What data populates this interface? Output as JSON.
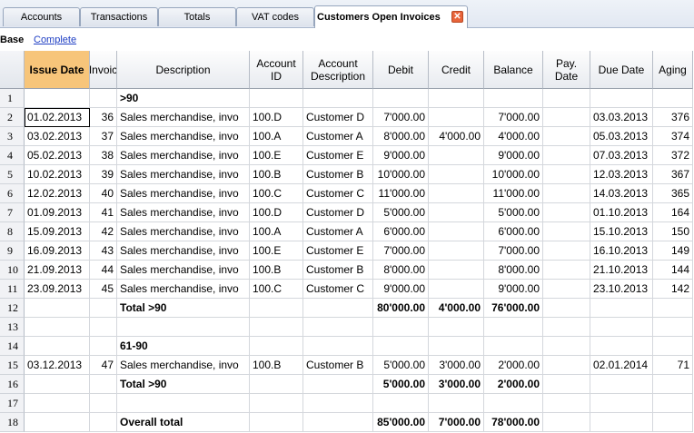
{
  "tabs": [
    {
      "label": "Accounts"
    },
    {
      "label": "Transactions"
    },
    {
      "label": "Totals"
    },
    {
      "label": "VAT codes"
    },
    {
      "label": "Customers Open Invoices",
      "active": true
    }
  ],
  "close_glyph": "✕",
  "views": {
    "base": "Base",
    "complete": "Complete"
  },
  "columns": [
    "Issue Date",
    "Invoic",
    "Description",
    "Account ID",
    "Account Description",
    "Debit",
    "Credit",
    "Balance",
    "Pay. Date",
    "Due Date",
    "Aging"
  ],
  "rows": [
    {
      "n": "1",
      "cells": [
        "",
        "",
        ">90",
        "",
        "",
        "",
        "",
        "",
        "",
        "",
        ""
      ],
      "bold": true
    },
    {
      "n": "2",
      "cells": [
        "01.02.2013",
        "36",
        "Sales merchandise, invo",
        "100.D",
        "Customer D",
        "7'000.00",
        "",
        "7'000.00",
        "",
        "03.03.2013",
        "376"
      ]
    },
    {
      "n": "3",
      "cells": [
        "03.02.2013",
        "37",
        "Sales merchandise, invo",
        "100.A",
        "Customer A",
        "8'000.00",
        "4'000.00",
        "4'000.00",
        "",
        "05.03.2013",
        "374"
      ]
    },
    {
      "n": "4",
      "cells": [
        "05.02.2013",
        "38",
        "Sales merchandise, invo",
        "100.E",
        "Customer E",
        "9'000.00",
        "",
        "9'000.00",
        "",
        "07.03.2013",
        "372"
      ]
    },
    {
      "n": "5",
      "cells": [
        "10.02.2013",
        "39",
        "Sales merchandise, invo",
        "100.B",
        "Customer B",
        "10'000.00",
        "",
        "10'000.00",
        "",
        "12.03.2013",
        "367"
      ]
    },
    {
      "n": "6",
      "cells": [
        "12.02.2013",
        "40",
        "Sales merchandise, invo",
        "100.C",
        "Customer C",
        "11'000.00",
        "",
        "11'000.00",
        "",
        "14.03.2013",
        "365"
      ]
    },
    {
      "n": "7",
      "cells": [
        "01.09.2013",
        "41",
        "Sales merchandise, invo",
        "100.D",
        "Customer D",
        "5'000.00",
        "",
        "5'000.00",
        "",
        "01.10.2013",
        "164"
      ]
    },
    {
      "n": "8",
      "cells": [
        "15.09.2013",
        "42",
        "Sales merchandise, invo",
        "100.A",
        "Customer A",
        "6'000.00",
        "",
        "6'000.00",
        "",
        "15.10.2013",
        "150"
      ]
    },
    {
      "n": "9",
      "cells": [
        "16.09.2013",
        "43",
        "Sales merchandise, invo",
        "100.E",
        "Customer E",
        "7'000.00",
        "",
        "7'000.00",
        "",
        "16.10.2013",
        "149"
      ]
    },
    {
      "n": "10",
      "cells": [
        "21.09.2013",
        "44",
        "Sales merchandise, invo",
        "100.B",
        "Customer B",
        "8'000.00",
        "",
        "8'000.00",
        "",
        "21.10.2013",
        "144"
      ]
    },
    {
      "n": "11",
      "cells": [
        "23.09.2013",
        "45",
        "Sales merchandise, invo",
        "100.C",
        "Customer C",
        "9'000.00",
        "",
        "9'000.00",
        "",
        "23.10.2013",
        "142"
      ]
    },
    {
      "n": "12",
      "cells": [
        "",
        "",
        "Total >90",
        "",
        "",
        "80'000.00",
        "4'000.00",
        "76'000.00",
        "",
        "",
        ""
      ],
      "bold": true
    },
    {
      "n": "13",
      "cells": [
        "",
        "",
        "",
        "",
        "",
        "",
        "",
        "",
        "",
        "",
        ""
      ]
    },
    {
      "n": "14",
      "cells": [
        "",
        "",
        "61-90",
        "",
        "",
        "",
        "",
        "",
        "",
        "",
        ""
      ],
      "bold": true
    },
    {
      "n": "15",
      "cells": [
        "03.12.2013",
        "47",
        "Sales merchandise, invo",
        "100.B",
        "Customer B",
        "5'000.00",
        "3'000.00",
        "2'000.00",
        "",
        "02.01.2014",
        "71"
      ]
    },
    {
      "n": "16",
      "cells": [
        "",
        "",
        "Total >90",
        "",
        "",
        "5'000.00",
        "3'000.00",
        "2'000.00",
        "",
        "",
        ""
      ],
      "bold": true
    },
    {
      "n": "17",
      "cells": [
        "",
        "",
        "",
        "",
        "",
        "",
        "",
        "",
        "",
        "",
        ""
      ]
    },
    {
      "n": "18",
      "cells": [
        "",
        "",
        "Overall total",
        "",
        "",
        "85'000.00",
        "7'000.00",
        "78'000.00",
        "",
        "",
        ""
      ],
      "bold": true
    }
  ]
}
